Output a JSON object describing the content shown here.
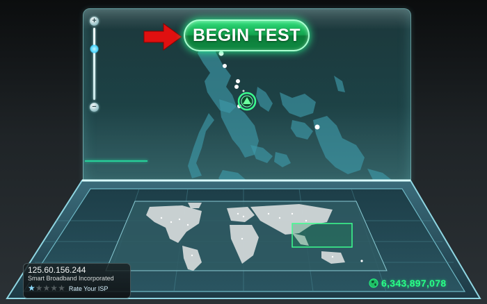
{
  "main": {
    "begin_test_label": "BEGIN TEST"
  },
  "zoom": {
    "plus_label": "+",
    "minus_label": "−"
  },
  "connection": {
    "ip": "125.60.156.244",
    "isp": "Smart Broadband Incorporated",
    "rating": 1,
    "rating_max": 5,
    "rate_label": "Rate Your ISP"
  },
  "counter": {
    "tests_count": "6,343,897,078",
    "icon": "globe-icon"
  },
  "colors": {
    "accent_green": "#28ff86",
    "button_green": "#13a34e",
    "arrow_red": "#e01010",
    "glass_teal": "#2a6a70"
  }
}
